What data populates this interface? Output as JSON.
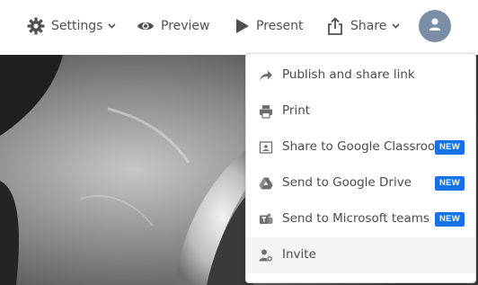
{
  "toolbar": {
    "settings_label": "Settings",
    "preview_label": "Preview",
    "present_label": "Present",
    "share_label": "Share"
  },
  "share_menu": {
    "items": [
      {
        "label": "Publish and share link",
        "icon": "share-arrow-icon",
        "badge": ""
      },
      {
        "label": "Print",
        "icon": "printer-icon",
        "badge": ""
      },
      {
        "label": "Share to Google Classroom",
        "icon": "google-classroom-icon",
        "badge": "NEW"
      },
      {
        "label": "Send to Google Drive",
        "icon": "google-drive-icon",
        "badge": "NEW"
      },
      {
        "label": "Send to Microsoft teams",
        "icon": "microsoft-teams-icon",
        "badge": "NEW"
      },
      {
        "label": "Invite",
        "icon": "add-user-icon",
        "badge": ""
      }
    ]
  },
  "colors": {
    "toolbar_text": "#505050",
    "accent_badge": "#1473e6",
    "avatar_bg": "#7a8ea6"
  }
}
